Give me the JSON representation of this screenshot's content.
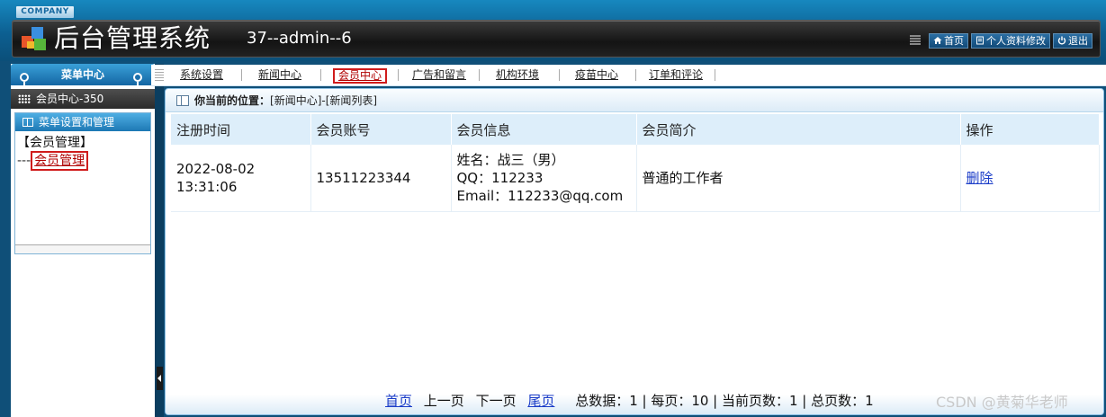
{
  "header": {
    "company": "COMPANY",
    "title": "后台管理系统",
    "user_info": "37--admin--6",
    "links": [
      {
        "label": "首页",
        "icon": "home-icon"
      },
      {
        "label": "个人资料修改",
        "icon": "document-icon"
      },
      {
        "label": "退出",
        "icon": "power-icon"
      }
    ]
  },
  "sidebar": {
    "title": "菜单中心",
    "module": "会员中心-350",
    "box_title": "菜单设置和管理",
    "group": "【会员管理】",
    "prefix": "---",
    "link": "会员管理"
  },
  "topnav": {
    "tabs": [
      "系统设置",
      "新闻中心",
      "会员中心",
      "广告和留言",
      "机构环境",
      "疫苗中心",
      "订单和评论"
    ],
    "active": "会员中心"
  },
  "location": {
    "label": "你当前的位置：",
    "path": "[新闻中心]-[新闻列表]"
  },
  "table": {
    "headers": [
      "注册时间",
      "会员账号",
      "会员信息",
      "会员简介",
      "操作"
    ],
    "rows": [
      {
        "date": "2022-08-02",
        "time": "13:31:06",
        "account": "13511223344",
        "info_name": "姓名：战三（男）",
        "info_qq": "QQ：112233",
        "info_email": "Email：112233@qq.com",
        "intro": "普通的工作者",
        "action": "删除"
      }
    ]
  },
  "pager": {
    "first": "首页",
    "prev": "上一页",
    "next": "下一页",
    "last": "尾页",
    "stats": "总数据：1 | 每页：10 | 当前页数：1 | 总页数：1"
  },
  "watermark": "CSDN @黄菊华老师"
}
